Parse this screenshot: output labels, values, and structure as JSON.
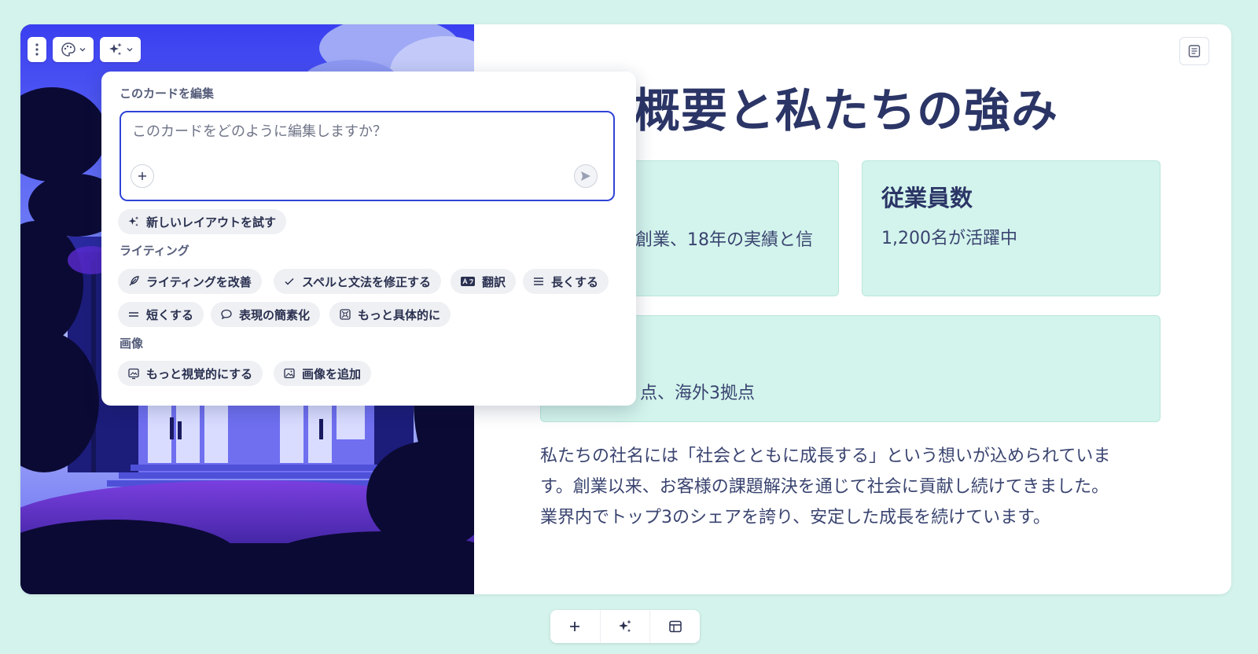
{
  "slide": {
    "title": "概要と私たちの強み",
    "stats": [
      {
        "title": "",
        "text": "創業、18年の実績と信"
      },
      {
        "title": "従業員数",
        "text": "1,200名が活躍中"
      },
      {
        "title": "",
        "text": "点、海外3拠点"
      }
    ],
    "body_lines": [
      "私たちの社名には「社会とともに成長する」という想いが込められていま",
      "す。創業以来、お客様の課題解決を通じて社会に貢献し続けてきました。",
      "業界内でトップ3のシェアを誇り、安定した成長を続けています。"
    ]
  },
  "edit_popup": {
    "heading": "このカードを編集",
    "prompt_placeholder": "このカードをどのように編集しますか？",
    "try_layout": "新しいレイアウトを試す",
    "writing_label": "ライティング",
    "writing_actions": [
      "ライティングを改善",
      "スペルと文法を修正する",
      "翻訳",
      "長くする",
      "短くする",
      "表現の簡素化",
      "もっと具体的に"
    ],
    "image_label": "画像",
    "image_actions": [
      "もっと視覚的にする",
      "画像を追加"
    ]
  },
  "icons": {
    "card_menu": "more-vertical-icon",
    "theme": "palette-icon",
    "ai": "sparkle-icon",
    "notes": "notes-icon",
    "add": "plus-icon",
    "send": "send-icon",
    "layout": "layout-icon"
  },
  "colors": {
    "background": "#d4f3ec",
    "accent": "#2f44d6",
    "heading": "#2b3566",
    "stat_box": "#d3f4ec"
  }
}
